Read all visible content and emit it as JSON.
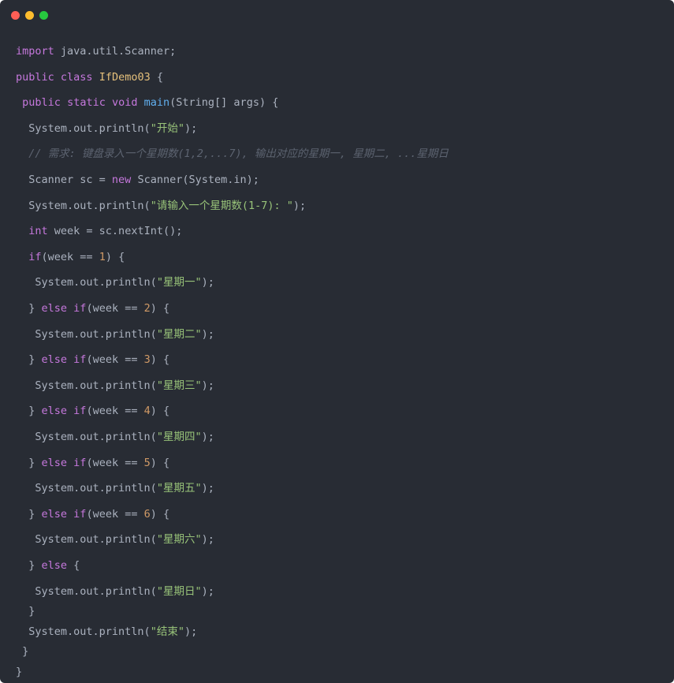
{
  "window": {
    "controls": [
      {
        "name": "close",
        "color": "#ff5f56"
      },
      {
        "name": "minimize",
        "color": "#ffbd2e"
      },
      {
        "name": "maximize",
        "color": "#27c93f"
      }
    ]
  },
  "theme": {
    "background": "#282c34",
    "plain": "#abb2bf",
    "keyword": "#c678dd",
    "type": "#e5c07b",
    "function": "#61afef",
    "string": "#98c379",
    "number": "#d19a66",
    "comment": "#5c6370"
  },
  "code": {
    "lines": [
      [
        {
          "t": "import",
          "k": "keyword"
        },
        {
          "t": " java.util.Scanner;",
          "k": "plain"
        }
      ],
      [
        {
          "t": "public",
          "k": "keyword"
        },
        {
          "t": " ",
          "k": "plain"
        },
        {
          "t": "class",
          "k": "keyword"
        },
        {
          "t": " ",
          "k": "plain"
        },
        {
          "t": "IfDemo03",
          "k": "type"
        },
        {
          "t": " {",
          "k": "plain"
        }
      ],
      [
        {
          "t": " ",
          "k": "plain"
        },
        {
          "t": "public",
          "k": "keyword"
        },
        {
          "t": " ",
          "k": "plain"
        },
        {
          "t": "static",
          "k": "keyword"
        },
        {
          "t": " ",
          "k": "plain"
        },
        {
          "t": "void",
          "k": "keyword"
        },
        {
          "t": " ",
          "k": "plain"
        },
        {
          "t": "main",
          "k": "function"
        },
        {
          "t": "(String[] args) {",
          "k": "plain"
        }
      ],
      [
        {
          "t": "  System.out.println(",
          "k": "plain"
        },
        {
          "t": "\"开始\"",
          "k": "string"
        },
        {
          "t": ");",
          "k": "plain"
        }
      ],
      [
        {
          "t": "  ",
          "k": "plain"
        },
        {
          "t": "// 需求: 键盘录入一个星期数(1,2,...7), 输出对应的星期一, 星期二, ...星期日",
          "k": "comment"
        }
      ],
      [
        {
          "t": "  Scanner sc = ",
          "k": "plain"
        },
        {
          "t": "new",
          "k": "keyword"
        },
        {
          "t": " Scanner(System.in);",
          "k": "plain"
        }
      ],
      [
        {
          "t": "  System.out.println(",
          "k": "plain"
        },
        {
          "t": "\"请输入一个星期数(1-7): \"",
          "k": "string"
        },
        {
          "t": ");",
          "k": "plain"
        }
      ],
      [
        {
          "t": "  ",
          "k": "plain"
        },
        {
          "t": "int",
          "k": "keyword"
        },
        {
          "t": " week = sc.nextInt();",
          "k": "plain"
        }
      ],
      [
        {
          "t": "  ",
          "k": "plain"
        },
        {
          "t": "if",
          "k": "keyword"
        },
        {
          "t": "(week == ",
          "k": "plain"
        },
        {
          "t": "1",
          "k": "number"
        },
        {
          "t": ") {",
          "k": "plain"
        }
      ],
      [
        {
          "t": "   System.out.println(",
          "k": "plain"
        },
        {
          "t": "\"星期一\"",
          "k": "string"
        },
        {
          "t": ");",
          "k": "plain"
        }
      ],
      [
        {
          "t": "  } ",
          "k": "plain"
        },
        {
          "t": "else",
          "k": "keyword"
        },
        {
          "t": " ",
          "k": "plain"
        },
        {
          "t": "if",
          "k": "keyword"
        },
        {
          "t": "(week == ",
          "k": "plain"
        },
        {
          "t": "2",
          "k": "number"
        },
        {
          "t": ") {",
          "k": "plain"
        }
      ],
      [
        {
          "t": "   System.out.println(",
          "k": "plain"
        },
        {
          "t": "\"星期二\"",
          "k": "string"
        },
        {
          "t": ");",
          "k": "plain"
        }
      ],
      [
        {
          "t": "  } ",
          "k": "plain"
        },
        {
          "t": "else",
          "k": "keyword"
        },
        {
          "t": " ",
          "k": "plain"
        },
        {
          "t": "if",
          "k": "keyword"
        },
        {
          "t": "(week == ",
          "k": "plain"
        },
        {
          "t": "3",
          "k": "number"
        },
        {
          "t": ") {",
          "k": "plain"
        }
      ],
      [
        {
          "t": "   System.out.println(",
          "k": "plain"
        },
        {
          "t": "\"星期三\"",
          "k": "string"
        },
        {
          "t": ");",
          "k": "plain"
        }
      ],
      [
        {
          "t": "  } ",
          "k": "plain"
        },
        {
          "t": "else",
          "k": "keyword"
        },
        {
          "t": " ",
          "k": "plain"
        },
        {
          "t": "if",
          "k": "keyword"
        },
        {
          "t": "(week == ",
          "k": "plain"
        },
        {
          "t": "4",
          "k": "number"
        },
        {
          "t": ") {",
          "k": "plain"
        }
      ],
      [
        {
          "t": "   System.out.println(",
          "k": "plain"
        },
        {
          "t": "\"星期四\"",
          "k": "string"
        },
        {
          "t": ");",
          "k": "plain"
        }
      ],
      [
        {
          "t": "  } ",
          "k": "plain"
        },
        {
          "t": "else",
          "k": "keyword"
        },
        {
          "t": " ",
          "k": "plain"
        },
        {
          "t": "if",
          "k": "keyword"
        },
        {
          "t": "(week == ",
          "k": "plain"
        },
        {
          "t": "5",
          "k": "number"
        },
        {
          "t": ") {",
          "k": "plain"
        }
      ],
      [
        {
          "t": "   System.out.println(",
          "k": "plain"
        },
        {
          "t": "\"星期五\"",
          "k": "string"
        },
        {
          "t": ");",
          "k": "plain"
        }
      ],
      [
        {
          "t": "  } ",
          "k": "plain"
        },
        {
          "t": "else",
          "k": "keyword"
        },
        {
          "t": " ",
          "k": "plain"
        },
        {
          "t": "if",
          "k": "keyword"
        },
        {
          "t": "(week == ",
          "k": "plain"
        },
        {
          "t": "6",
          "k": "number"
        },
        {
          "t": ") {",
          "k": "plain"
        }
      ],
      [
        {
          "t": "   System.out.println(",
          "k": "plain"
        },
        {
          "t": "\"星期六\"",
          "k": "string"
        },
        {
          "t": ");",
          "k": "plain"
        }
      ],
      [
        {
          "t": "  } ",
          "k": "plain"
        },
        {
          "t": "else",
          "k": "keyword"
        },
        {
          "t": " {",
          "k": "plain"
        }
      ],
      [
        {
          "t": "   System.out.println(",
          "k": "plain"
        },
        {
          "t": "\"星期日\"",
          "k": "string"
        },
        {
          "t": ");",
          "k": "plain"
        }
      ],
      [
        {
          "t": "  }",
          "k": "plain"
        }
      ],
      [
        {
          "t": "  System.out.println(",
          "k": "plain"
        },
        {
          "t": "\"结束\"",
          "k": "string"
        },
        {
          "t": ");",
          "k": "plain"
        }
      ],
      [
        {
          "t": " }",
          "k": "plain"
        }
      ],
      [
        {
          "t": "}",
          "k": "plain"
        }
      ]
    ]
  }
}
